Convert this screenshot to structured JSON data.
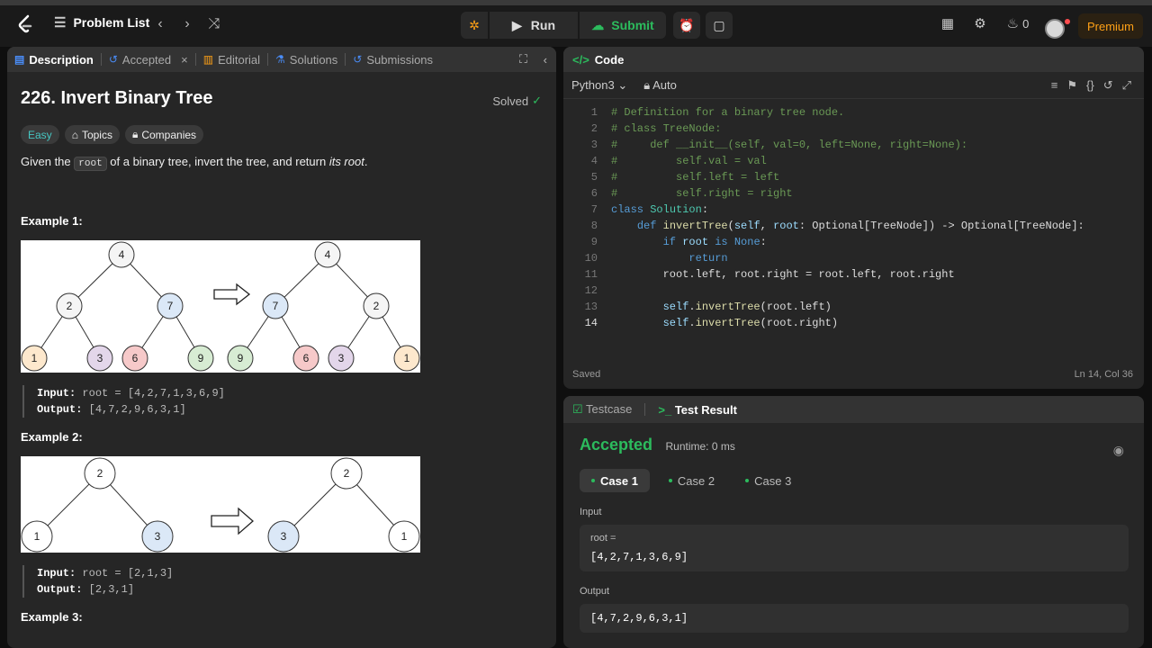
{
  "topbar": {
    "problem_list": "Problem List",
    "run": "Run",
    "submit": "Submit",
    "fire_count": "0",
    "premium": "Premium"
  },
  "left_tabs": [
    "Description",
    "Accepted",
    "Editorial",
    "Solutions",
    "Submissions"
  ],
  "problem": {
    "title": "226. Invert Binary Tree",
    "solved": "Solved",
    "difficulty": "Easy",
    "topics": "Topics",
    "companies": "Companies",
    "desc_pre": "Given the ",
    "desc_code": "root",
    "desc_mid": " of a binary tree, invert the tree, and return ",
    "desc_em": "its root",
    "desc_end": ".",
    "example1": "Example 1:",
    "ex1_input_label": "Input:",
    "ex1_input": "root = [4,2,7,1,3,6,9]",
    "ex1_output_label": "Output:",
    "ex1_output": "[4,7,2,9,6,3,1]",
    "example2": "Example 2:",
    "ex2_input_label": "Input:",
    "ex2_input": "root = [2,1,3]",
    "ex2_output_label": "Output:",
    "ex2_output": "[2,3,1]",
    "example3": "Example 3:"
  },
  "code": {
    "header": "Code",
    "language": "Python3",
    "auto": "Auto",
    "status": "Saved",
    "cursor": "Ln 14, Col 36"
  },
  "result": {
    "tab1": "Testcase",
    "tab2": "Test Result",
    "verdict": "Accepted",
    "runtime": "Runtime: 0 ms",
    "cases": [
      "Case 1",
      "Case 2",
      "Case 3"
    ],
    "input_label": "Input",
    "root_label": "root =",
    "input_value": "[4,2,7,1,3,6,9]",
    "output_label": "Output",
    "output_value": "[4,7,2,9,6,3,1]"
  },
  "colors": {
    "accent_green": "#2cbb5d",
    "premium": "#ffa116",
    "easy": "#46c6c2"
  }
}
